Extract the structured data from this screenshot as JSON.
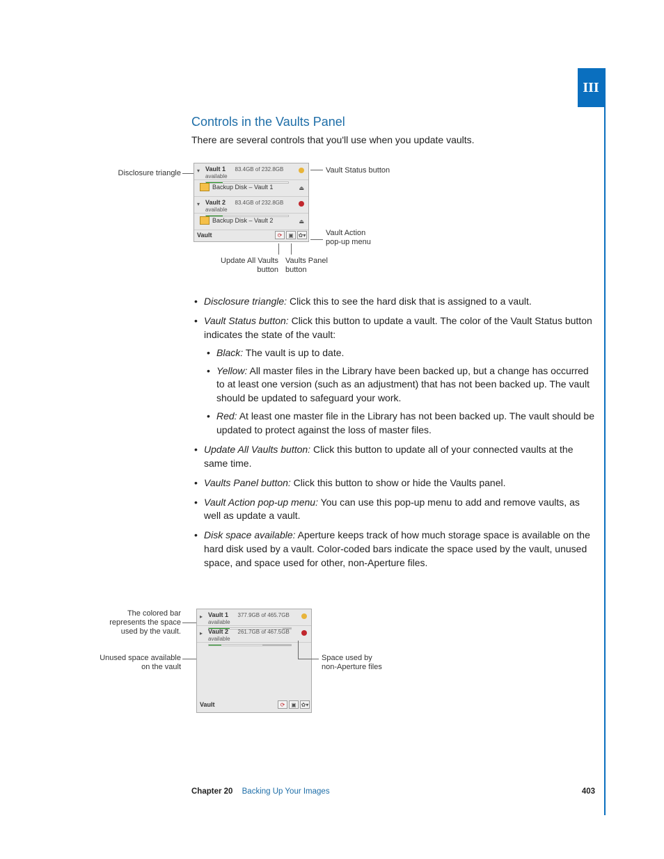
{
  "tab": "III",
  "heading": "Controls in the Vaults Panel",
  "intro": "There are several controls that you'll use when you update vaults.",
  "fig1": {
    "callouts": {
      "disclosure": "Disclosure triangle",
      "vaultStatus": "Vault Status button",
      "vaultAction1": "Vault Action",
      "vaultAction2": "pop-up menu",
      "updateAll1": "Update All Vaults",
      "updateAll2": "button",
      "vaultsPanel1": "Vaults Panel",
      "vaultsPanel2": "button"
    },
    "panel": {
      "v1": {
        "name": "Vault 1",
        "avail": "83.4GB of 232.8GB available"
      },
      "d1": "Backup Disk – Vault 1",
      "v2": {
        "name": "Vault 2",
        "avail": "83.4GB of 232.8GB available"
      },
      "d2": "Backup Disk – Vault 2",
      "footer": "Vault"
    }
  },
  "fig2": {
    "callouts": {
      "colored1": "The colored bar",
      "colored2": "represents the space",
      "colored3": "used by the vault.",
      "unused1": "Unused space available",
      "unused2": "on the vault",
      "other1": "Space used by",
      "other2": "non-Aperture files"
    },
    "panel": {
      "v1": {
        "name": "Vault 1",
        "avail": "377.9GB of 465.7GB available"
      },
      "v2": {
        "name": "Vault 2",
        "avail": "261.7GB of 467.5GB available"
      },
      "footer": "Vault"
    }
  },
  "bullets": {
    "disclosure": {
      "t": "Disclosure triangle:",
      "b": "  Click this to see the hard disk that is assigned to a vault."
    },
    "status": {
      "t": "Vault Status button:",
      "b": "  Click this button to update a vault. The color of the Vault Status button indicates the state of the vault:"
    },
    "black": {
      "t": "Black:",
      "b": "  The vault is up to date."
    },
    "yellow": {
      "t": "Yellow:",
      "b": "  All master files in the Library have been backed up, but a change has occurred to at least one version (such as an adjustment) that has not been backed up. The vault should be updated to safeguard your work."
    },
    "red": {
      "t": "Red:",
      "b": "  At least one master file in the Library has not been backed up. The vault should be updated to protect against the loss of master files."
    },
    "updateAll": {
      "t": "Update All Vaults button:",
      "b": "  Click this button to update all of your connected vaults at the same time."
    },
    "panelBtn": {
      "t": "Vaults Panel button:",
      "b": "  Click this button to show or hide the Vaults panel."
    },
    "actionMenu": {
      "t": "Vault Action pop-up menu:",
      "b": "  You can use this pop-up menu to add and remove vaults, as well as update a vault."
    },
    "diskSpace": {
      "t": "Disk space available:",
      "b": "  Aperture keeps track of how much storage space is available on the hard disk used by a vault. Color-coded bars indicate the space used by the vault, unused space, and space used for other, non-Aperture files."
    }
  },
  "footer": {
    "chapter": "Chapter 20",
    "title": "Backing Up Your Images",
    "page": "403"
  }
}
